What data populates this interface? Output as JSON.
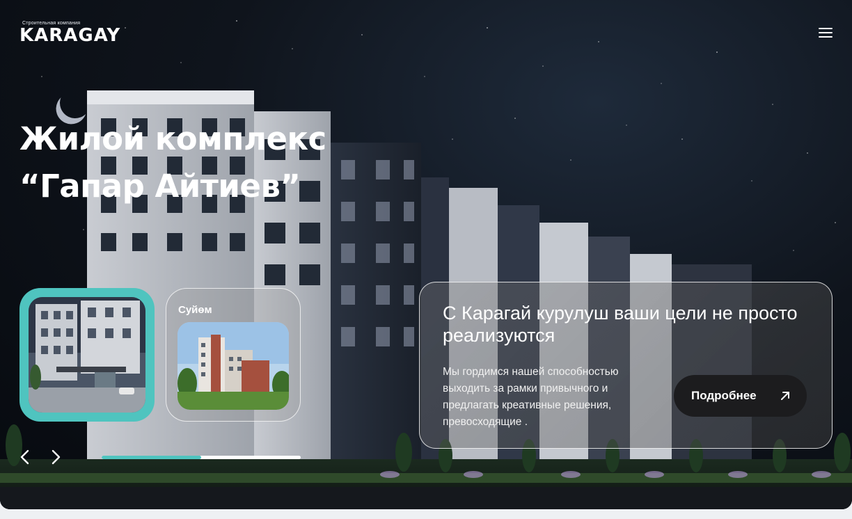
{
  "brand": {
    "tagline": "Строительная компания",
    "name": "KARAGAY"
  },
  "hero": {
    "title_line1": "Жилой комплекс",
    "title_line2": "“Гапар Айтиев”"
  },
  "slider": {
    "next_project_label": "Суйөм",
    "progress": 0.5,
    "accent_color": "#4fc4bf"
  },
  "info": {
    "title": "С Карагай курулуш ваши цели не просто реализуются",
    "text": "Мы гордимся нашей способностью выходить за рамки привычного и предлагать креативные решения, превосходящие .",
    "button_label": "Подробнее"
  },
  "icons": {
    "menu": "hamburger-icon",
    "prev": "chevron-left-icon",
    "next": "chevron-right-icon",
    "button": "arrow-up-right-icon"
  }
}
